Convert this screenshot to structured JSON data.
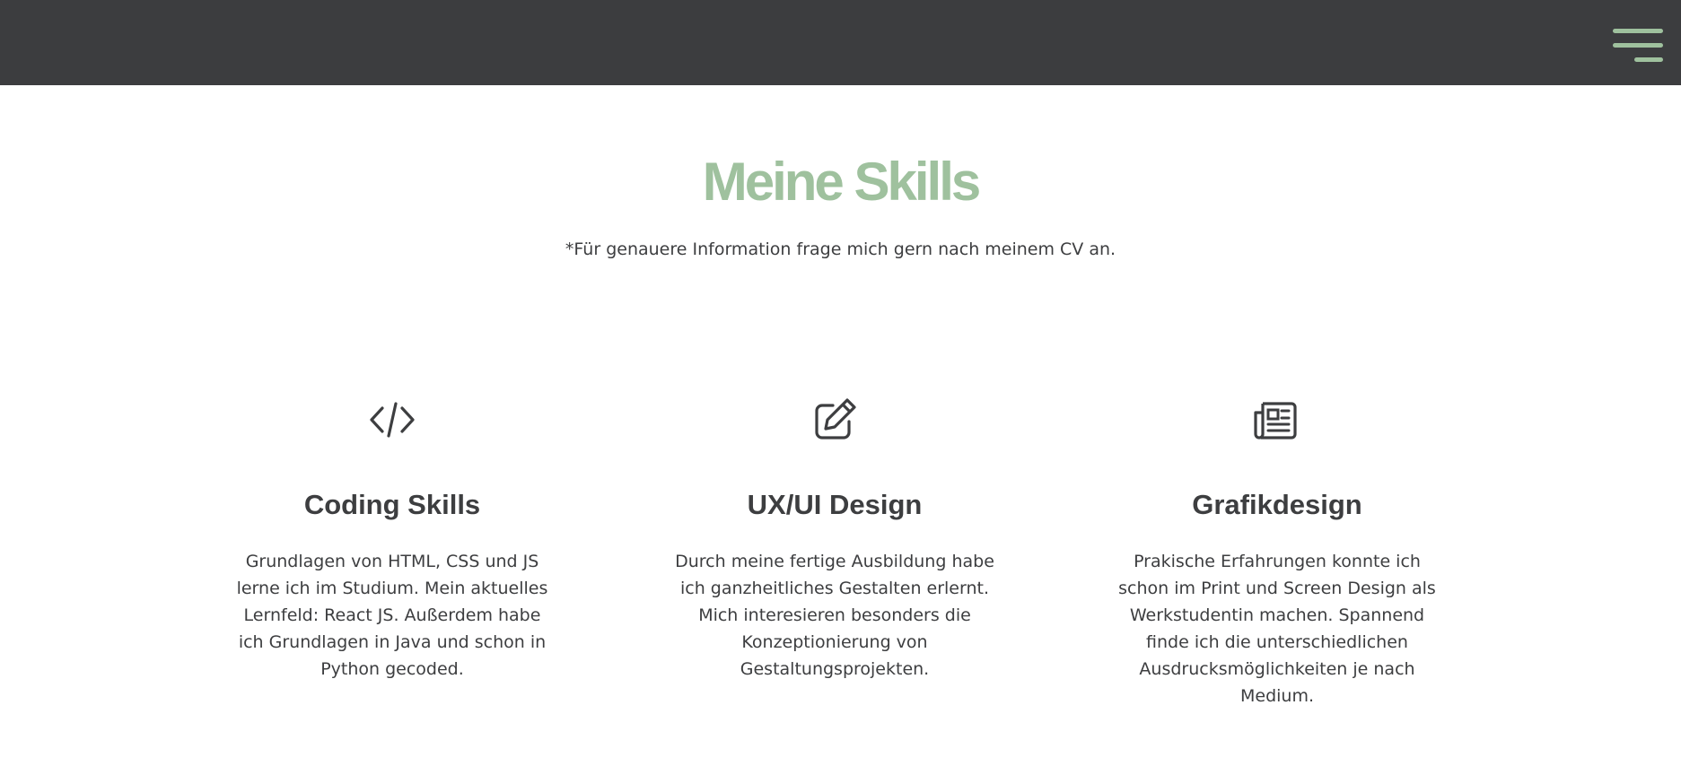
{
  "header": {
    "menu_icon": "hamburger-menu-icon",
    "accent_color": "#9fc19e",
    "background_color": "#3c3d3f"
  },
  "skills": {
    "title": "Meine Skills",
    "note": "*Für genauere Information frage mich gern nach meinem CV an.",
    "cards": [
      {
        "icon": "code-icon",
        "title": "Coding Skills",
        "text": "Grundlagen von HTML, CSS und JS lerne ich im Studium. Mein aktuelles Lernfeld: React JS. Außerdem habe ich Grundlagen in Java und schon in Python gecoded."
      },
      {
        "icon": "pen-to-square-icon",
        "title": "UX/UI Design",
        "text": "Durch meine fertige Ausbildung habe ich ganzheitliches Gestalten erlernt. Mich interesieren besonders die Konzeptionierung von Gestaltungsprojekten."
      },
      {
        "icon": "newspaper-icon",
        "title": "Grafikdesign",
        "text": "Prakische Erfahrungen konnte ich schon im Print und Screen Design als Werkstudentin machen. Spannend finde ich die unterschiedlichen Ausdrucksmöglichkeiten je nach Medium."
      }
    ]
  }
}
